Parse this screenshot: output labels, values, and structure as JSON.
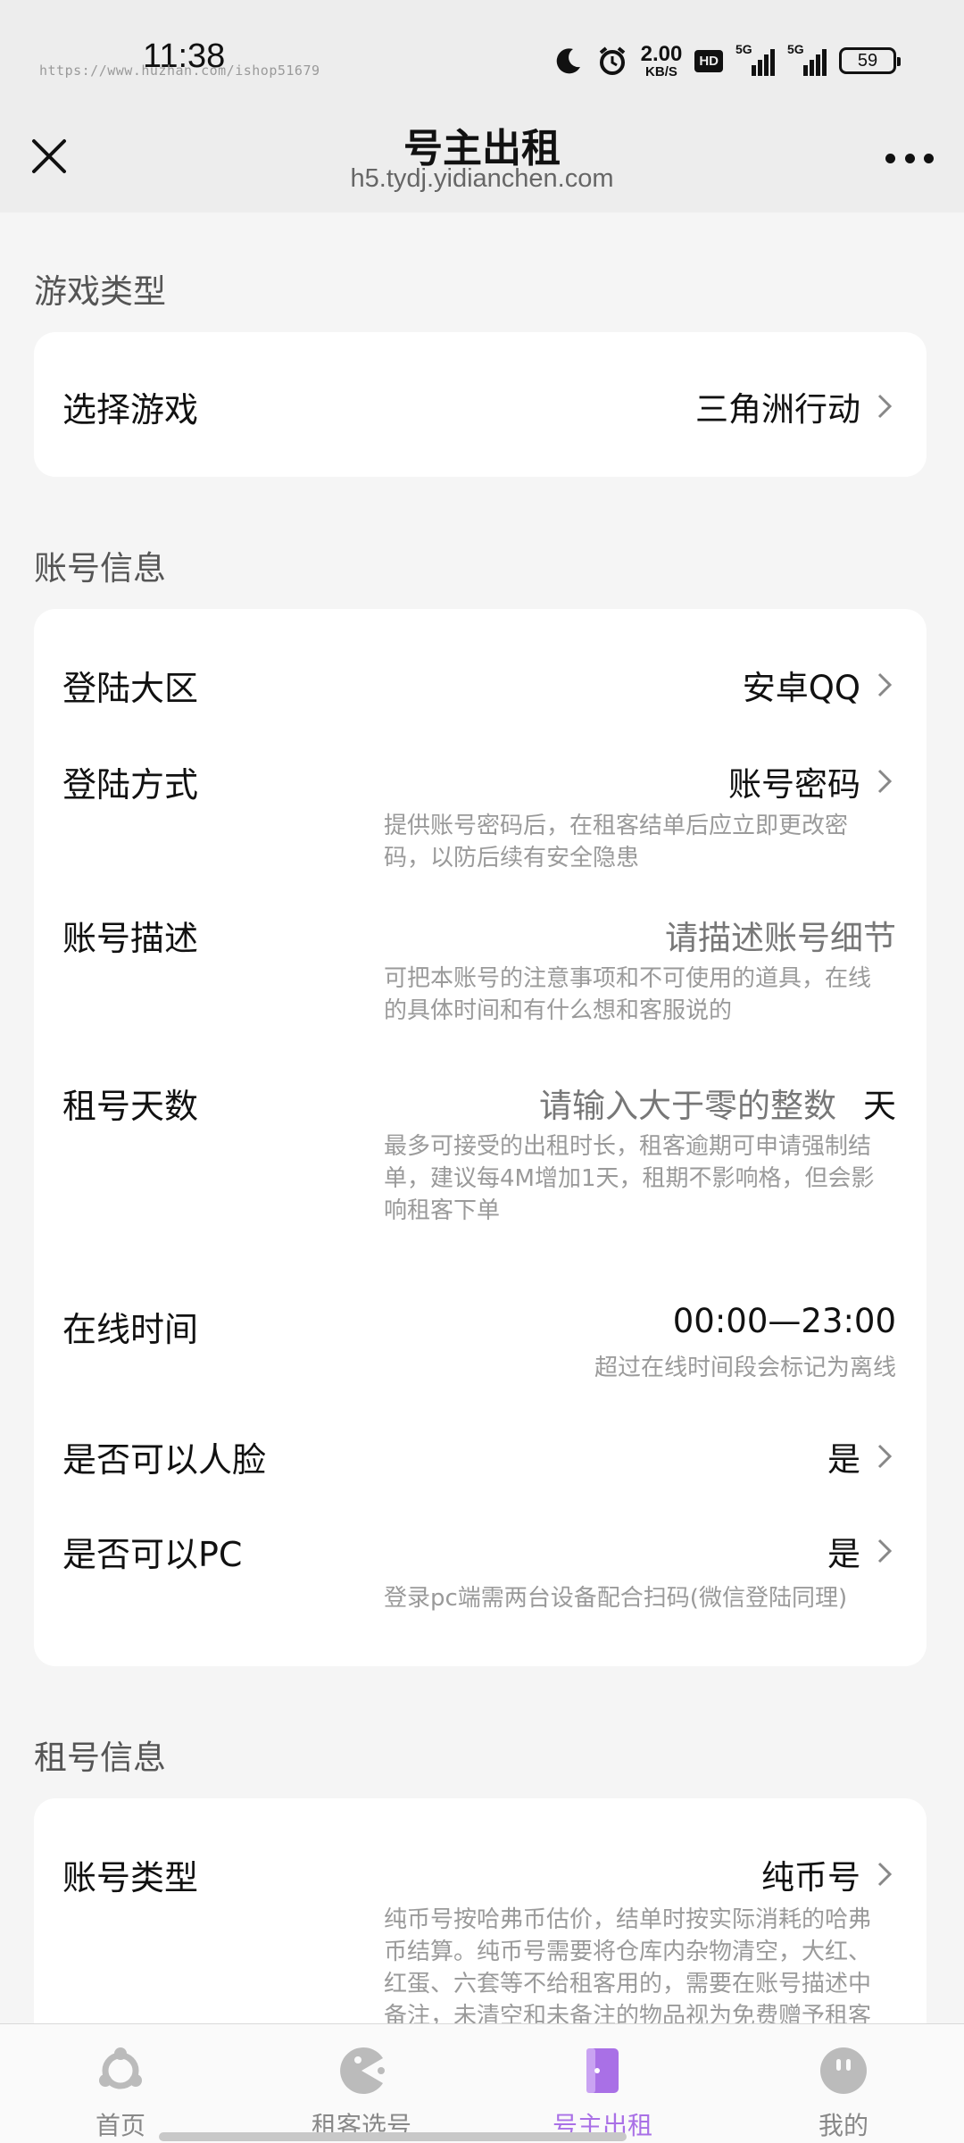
{
  "status_bar": {
    "time": "11:38",
    "watermark": "https://www.huzhan.com/ishop51679",
    "speed_value": "2.00",
    "speed_unit": "KB/S",
    "hd_badge": "HD",
    "signal1_label": "5G",
    "signal2_label": "5G",
    "battery": "59",
    "icons": [
      "moon-icon",
      "alarm-icon",
      "hd-icon",
      "signal-icon",
      "signal-icon",
      "battery-icon"
    ]
  },
  "header": {
    "title": "号主出租",
    "url": "h5.tydj.yidianchen.com",
    "close_icon": "close-icon",
    "more_icon": "more-icon"
  },
  "sections": {
    "game_type": {
      "title": "游戏类型",
      "select_game": {
        "label": "选择游戏",
        "value": "三角洲行动"
      }
    },
    "account_info": {
      "title": "账号信息",
      "login_region": {
        "label": "登陆大区",
        "value": "安卓QQ"
      },
      "login_method": {
        "label": "登陆方式",
        "value": "账号密码",
        "hint_line1": "提供账号密码后，在租客结单后应立即更改密",
        "hint_line2": "码，以防后续有安全隐患"
      },
      "account_desc": {
        "label": "账号描述",
        "placeholder": "请描述账号细节",
        "hint_line1": "可把本账号的注意事项和不可使用的道具，在线",
        "hint_line2": "的具体时间和有什么想和客服说的"
      },
      "rental_days": {
        "label": "租号天数",
        "placeholder": "请输入大于零的整数",
        "unit": "天",
        "hint_line1": "最多可接受的出租时长，租客逾期可申请强制结",
        "hint_line2": "单，建议每4M增加1天，租期不影响格，但会影",
        "hint_line3": "响租客下单"
      },
      "online_time": {
        "label": "在线时间",
        "value": "00:00—23:00",
        "hint": "超过在线时间段会标记为离线"
      },
      "face_allowed": {
        "label": "是否可以人脸",
        "value": "是"
      },
      "pc_allowed": {
        "label": "是否可以PC",
        "value": "是",
        "hint": "登录pc端需两台设备配合扫码(微信登陆同理)"
      }
    },
    "rental_info": {
      "title": "租号信息",
      "account_type": {
        "label": "账号类型",
        "value": "纯币号",
        "hint_line1": "纯币号按哈弗币估价，结单时按实际消耗的哈弗",
        "hint_line2": "币结算。纯币号需要将仓库内杂物清空，大红、",
        "hint_line3": "红蛋、六套等不给租客用的，需要在账号描述中",
        "hint_line4": "备注，未清空和未备注的物品视为免费赠予租客"
      }
    }
  },
  "tabbar": {
    "tabs": [
      {
        "label": "首页",
        "icon": "home-icon",
        "active": false
      },
      {
        "label": "租客选号",
        "icon": "pacman-icon",
        "active": false
      },
      {
        "label": "号主出租",
        "icon": "door-icon",
        "active": true
      },
      {
        "label": "我的",
        "icon": "profile-icon",
        "active": false
      }
    ]
  },
  "colors": {
    "accent": "#a970e6",
    "background": "#f5f5f5",
    "header_bg": "#ededed"
  }
}
